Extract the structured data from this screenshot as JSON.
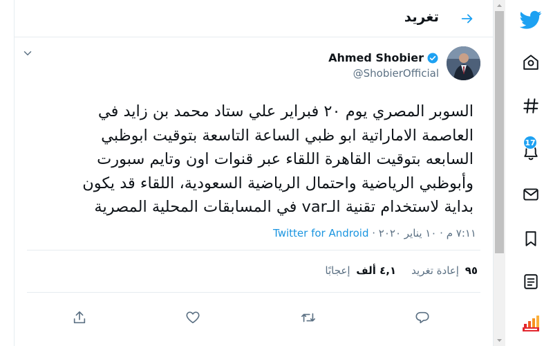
{
  "header": {
    "title": "تغريد"
  },
  "tweet": {
    "author_name": "Ahmed Shobier",
    "author_handle": "@ShobierOfficial",
    "text": "السوبر المصري يوم ٢٠ فبراير علي ستاد محمد بن زايد في\nالعاصمة الاماراتية ابو ظبي الساعة التاسعة بتوقيت ابوظبي\nالسابعه بتوقيت القاهرة اللقاء عبر قنوات اون وتايم سبورت\nوأبوظبي الرياضية واحتمال الرياضية السعودية، اللقاء قد يكون\nبداية لاستخدام تقنية الـvar في المسابقات المحلية المصرية",
    "time": "٧:١١ م · ١٠ يناير ٢٠٢٠",
    "separator": " · ",
    "source": "Twitter for Android",
    "retweets_count": "٩٥",
    "retweets_label": "إعادة تغريد",
    "likes_count": "٤,١ ألف",
    "likes_label": "إعجابًا"
  },
  "sidebar": {
    "notifications_badge": "17"
  },
  "colors": {
    "accent": "#1da1f2",
    "verified": "#1da1f2",
    "secondary_text": "#5b7083"
  },
  "icons": [
    "twitter-logo-icon",
    "home-icon",
    "explore-hash-icon",
    "notifications-bell-icon",
    "messages-mail-icon",
    "bookmarks-icon",
    "lists-icon",
    "profile-logo-icon",
    "back-arrow-icon",
    "verified-badge-icon",
    "caret-down-icon",
    "share-icon",
    "like-heart-icon",
    "retweet-icon",
    "reply-icon"
  ]
}
